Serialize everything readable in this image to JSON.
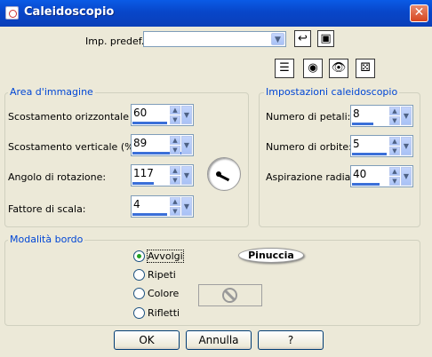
{
  "window": {
    "title": "Caleidoscopio",
    "close_label": "✕"
  },
  "preset": {
    "label": "Imp. predef.:",
    "value": ""
  },
  "area": {
    "title": "Area d'immagine",
    "rows": [
      {
        "label": "Scostamento orizzontale (%):",
        "value": "60",
        "fill": 0.55
      },
      {
        "label": "Scostamento verticale (%):",
        "value": "89",
        "fill": 0.9
      },
      {
        "label": "Angolo di rotazione:",
        "value": "117",
        "fill": 0.33
      },
      {
        "label": "Fattore di scala:",
        "value": "4",
        "fill": 0.55
      }
    ]
  },
  "settings": {
    "title": "Impostazioni caleidoscopio",
    "rows": [
      {
        "label": "Numero di petali:",
        "value": "8",
        "fill": 0.35
      },
      {
        "label": "Numero di orbite:",
        "value": "5",
        "fill": 0.55
      },
      {
        "label": "Aspirazione radiale:",
        "value": "40",
        "fill": 0.45
      }
    ]
  },
  "border": {
    "title": "Modalità bordo",
    "options": [
      "Avvolgi",
      "Ripeti",
      "Colore",
      "Rifletti"
    ],
    "selected": "Avvolgi"
  },
  "logo_text": "Pinuccia",
  "buttons": {
    "ok": "OK",
    "cancel": "Annulla",
    "help": "?"
  },
  "icons": [
    "save-preset-icon",
    "save-icon",
    "proof-icon",
    "preview-eye-icon",
    "eye-toggle-icon",
    "randomize-dice-icon",
    "no-sign-icon",
    "rotation-dial"
  ]
}
